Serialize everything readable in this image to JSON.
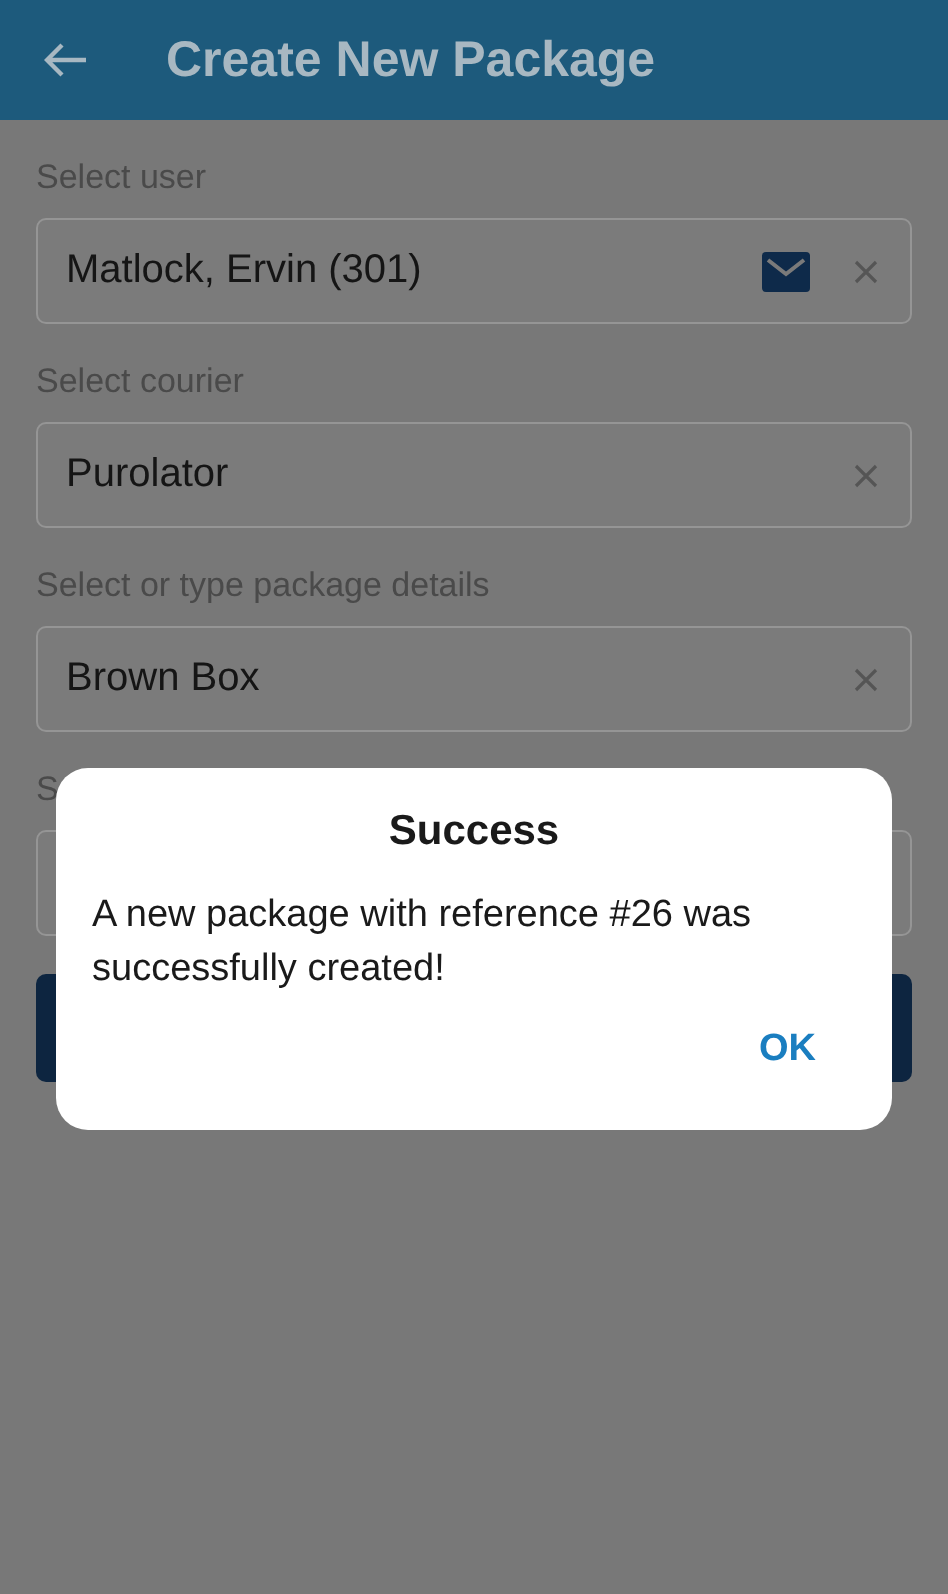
{
  "header": {
    "title": "Create New Package"
  },
  "fields": [
    {
      "label": "Select user",
      "value": "Matlock, Ervin (301)",
      "kind": "contact"
    },
    {
      "label": "Select courier",
      "value": "Purolator",
      "kind": "select"
    },
    {
      "label": "Select or type package details",
      "value": "Brown Box",
      "kind": "select"
    },
    {
      "label": "S",
      "kind": "covered"
    }
  ],
  "dialog": {
    "title": "Success",
    "message": "A new package with reference #26 was successfully created!",
    "button": "OK"
  }
}
